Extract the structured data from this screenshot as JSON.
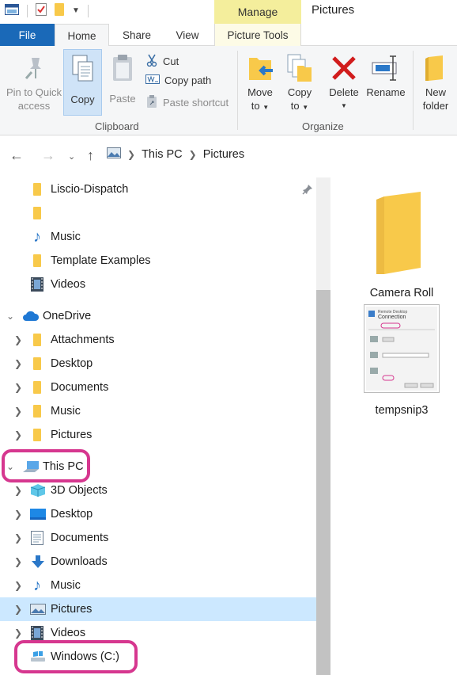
{
  "window": {
    "title": "Pictures"
  },
  "contextual_tab": {
    "label": "Manage"
  },
  "tabs": [
    {
      "label": "File"
    },
    {
      "label": "Home"
    },
    {
      "label": "Share"
    },
    {
      "label": "View"
    },
    {
      "label": "Picture Tools"
    }
  ],
  "ribbon": {
    "pin": {
      "line1": "Pin to Quick",
      "line2": "access"
    },
    "copy": "Copy",
    "paste": "Paste",
    "cut": "Cut",
    "copy_path": "Copy path",
    "paste_shortcut": "Paste shortcut",
    "clipboard_group": "Clipboard",
    "move_to": {
      "line1": "Move",
      "line2": "to"
    },
    "copy_to": {
      "line1": "Copy",
      "line2": "to"
    },
    "delete": "Delete",
    "rename": "Rename",
    "organize_group": "Organize",
    "new_folder": {
      "line1": "New",
      "line2": "folder"
    }
  },
  "address": {
    "crumb1": "This PC",
    "crumb2": "Pictures"
  },
  "nav": {
    "quick": [
      {
        "label": "Liscio-Dispatch"
      },
      {
        "label": ""
      },
      {
        "label": "Music"
      },
      {
        "label": "Template Examples"
      },
      {
        "label": "Videos"
      }
    ],
    "onedrive": "OneDrive",
    "onedrive_items": [
      {
        "label": "Attachments"
      },
      {
        "label": "Desktop"
      },
      {
        "label": "Documents"
      },
      {
        "label": "Music"
      },
      {
        "label": "Pictures"
      }
    ],
    "thispc": "This PC",
    "thispc_items": [
      {
        "label": "3D Objects"
      },
      {
        "label": "Desktop"
      },
      {
        "label": "Documents"
      },
      {
        "label": "Downloads"
      },
      {
        "label": "Music"
      },
      {
        "label": "Pictures"
      },
      {
        "label": "Videos"
      },
      {
        "label": "Windows (C:)"
      }
    ]
  },
  "content": {
    "items": [
      {
        "name": "Camera Roll",
        "type": "folder"
      },
      {
        "name": "tempsnip3",
        "type": "image"
      }
    ],
    "thumb_text": {
      "title": "Remote Desktop",
      "subtitle": "Connection"
    }
  },
  "colors": {
    "accent": "#1a69b8",
    "selection": "#cce8ff",
    "manage_tab": "#f4ee9c",
    "highlight": "#d6378f",
    "folder": "#f8c94a"
  }
}
